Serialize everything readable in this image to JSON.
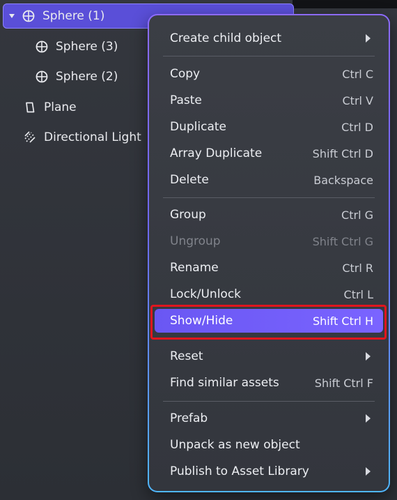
{
  "tree": {
    "items": [
      {
        "label": "Sphere (1)",
        "icon": "sphere-icon",
        "selected": true
      },
      {
        "label": "Sphere (3)",
        "icon": "sphere-icon"
      },
      {
        "label": "Sphere (2)",
        "icon": "sphere-icon"
      },
      {
        "label": "Plane",
        "icon": "plane-icon"
      },
      {
        "label": "Directional Light",
        "icon": "light-icon"
      }
    ]
  },
  "menu": {
    "items": [
      {
        "label": "Create child object",
        "shortcut": "",
        "submenu": true
      },
      {
        "label": "Copy",
        "shortcut": "Ctrl C"
      },
      {
        "label": "Paste",
        "shortcut": "Ctrl V"
      },
      {
        "label": "Duplicate",
        "shortcut": "Ctrl D"
      },
      {
        "label": "Array Duplicate",
        "shortcut": "Shift Ctrl D"
      },
      {
        "label": "Delete",
        "shortcut": "Backspace"
      },
      {
        "label": "Group",
        "shortcut": "Ctrl G"
      },
      {
        "label": "Ungroup",
        "shortcut": "Shift Ctrl G",
        "disabled": true
      },
      {
        "label": "Rename",
        "shortcut": "Ctrl R"
      },
      {
        "label": "Lock/Unlock",
        "shortcut": "Ctrl L"
      },
      {
        "label": "Show/Hide",
        "shortcut": "Shift Ctrl H",
        "active": true
      },
      {
        "label": "Reset",
        "shortcut": "",
        "submenu": true
      },
      {
        "label": "Find similar assets",
        "shortcut": "Shift Ctrl F"
      },
      {
        "label": "Prefab",
        "shortcut": "",
        "submenu": true
      },
      {
        "label": "Unpack as new object",
        "shortcut": ""
      },
      {
        "label": "Publish to Asset Library",
        "shortcut": "",
        "submenu": true
      }
    ]
  },
  "colors": {
    "accent": "#6a57f3",
    "highlight_outline": "#e0161e",
    "menu_background": "#3b3e45",
    "panel_background": "#2f3238"
  }
}
